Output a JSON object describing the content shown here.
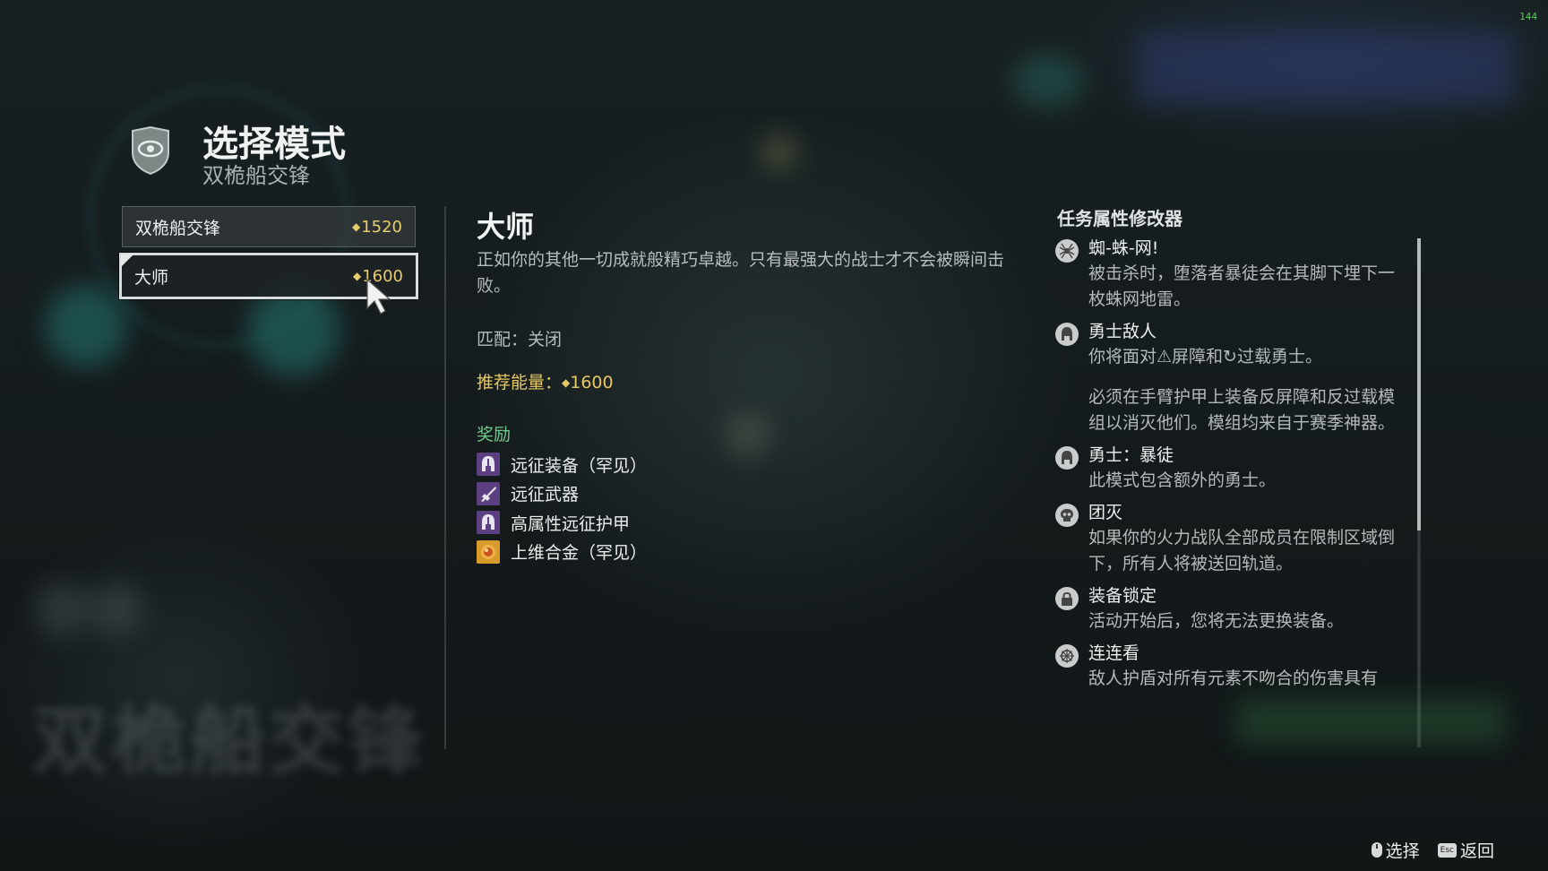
{
  "overlay": {
    "fps": "144"
  },
  "background": {
    "blurred_activity_name": "双桅船交锋"
  },
  "header": {
    "title": "选择模式",
    "subtitle": "双桅船交锋",
    "emblem_icon": "vanguard-shield-icon"
  },
  "modes": [
    {
      "label": "双桅船交锋",
      "power": "1520",
      "selected": false
    },
    {
      "label": "大师",
      "power": "1600",
      "selected": true
    }
  ],
  "detail": {
    "title": "大师",
    "description": "正如你的其他一切成就般精巧卓越。只有最强大的战士才不会被瞬间击败。",
    "matchmaking": "匹配：关闭",
    "recommended_power_label": "推荐能量：",
    "recommended_power": "1600",
    "rewards_heading": "奖励",
    "rewards": [
      {
        "label": "远征装备（罕见）",
        "icon": "helmet-icon"
      },
      {
        "label": "远征武器",
        "icon": "weapon-icon"
      },
      {
        "label": "高属性远征护甲",
        "icon": "helmet-icon"
      },
      {
        "label": "上维合金（罕见）",
        "icon": "ascendant-alloy-icon"
      }
    ]
  },
  "modifiers": {
    "heading": "任务属性修改器",
    "items": [
      {
        "name": "蜘-蛛-网!",
        "desc": [
          "被击杀时，堕落者暴徒会在其脚下埋下一枚蛛网地雷。"
        ],
        "icon": "spider-icon"
      },
      {
        "name": "勇士敌人",
        "desc": [
          "你将面对⚠屏障和↻过载勇士。",
          "必须在手臂护甲上装备反屏障和反过载模组以消灭他们。模组均来自于赛季神器。"
        ],
        "icon": "champion-icon"
      },
      {
        "name": "勇士：暴徒",
        "desc": [
          "此模式包含额外的勇士。"
        ],
        "icon": "champion-icon"
      },
      {
        "name": "团灭",
        "desc": [
          "如果你的火力战队全部成员在限制区域倒下，所有人将被送回轨道。"
        ],
        "icon": "skull-icon"
      },
      {
        "name": "装备锁定",
        "desc": [
          "活动开始后，您将无法更换装备。"
        ],
        "icon": "lock-icon"
      },
      {
        "name": "连连看",
        "desc": [
          "敌人护盾对所有元素不吻合的伤害具有"
        ],
        "icon": "match-game-icon"
      }
    ]
  },
  "footer": {
    "select": "选择",
    "back": "返回",
    "back_key": "Esc"
  }
}
